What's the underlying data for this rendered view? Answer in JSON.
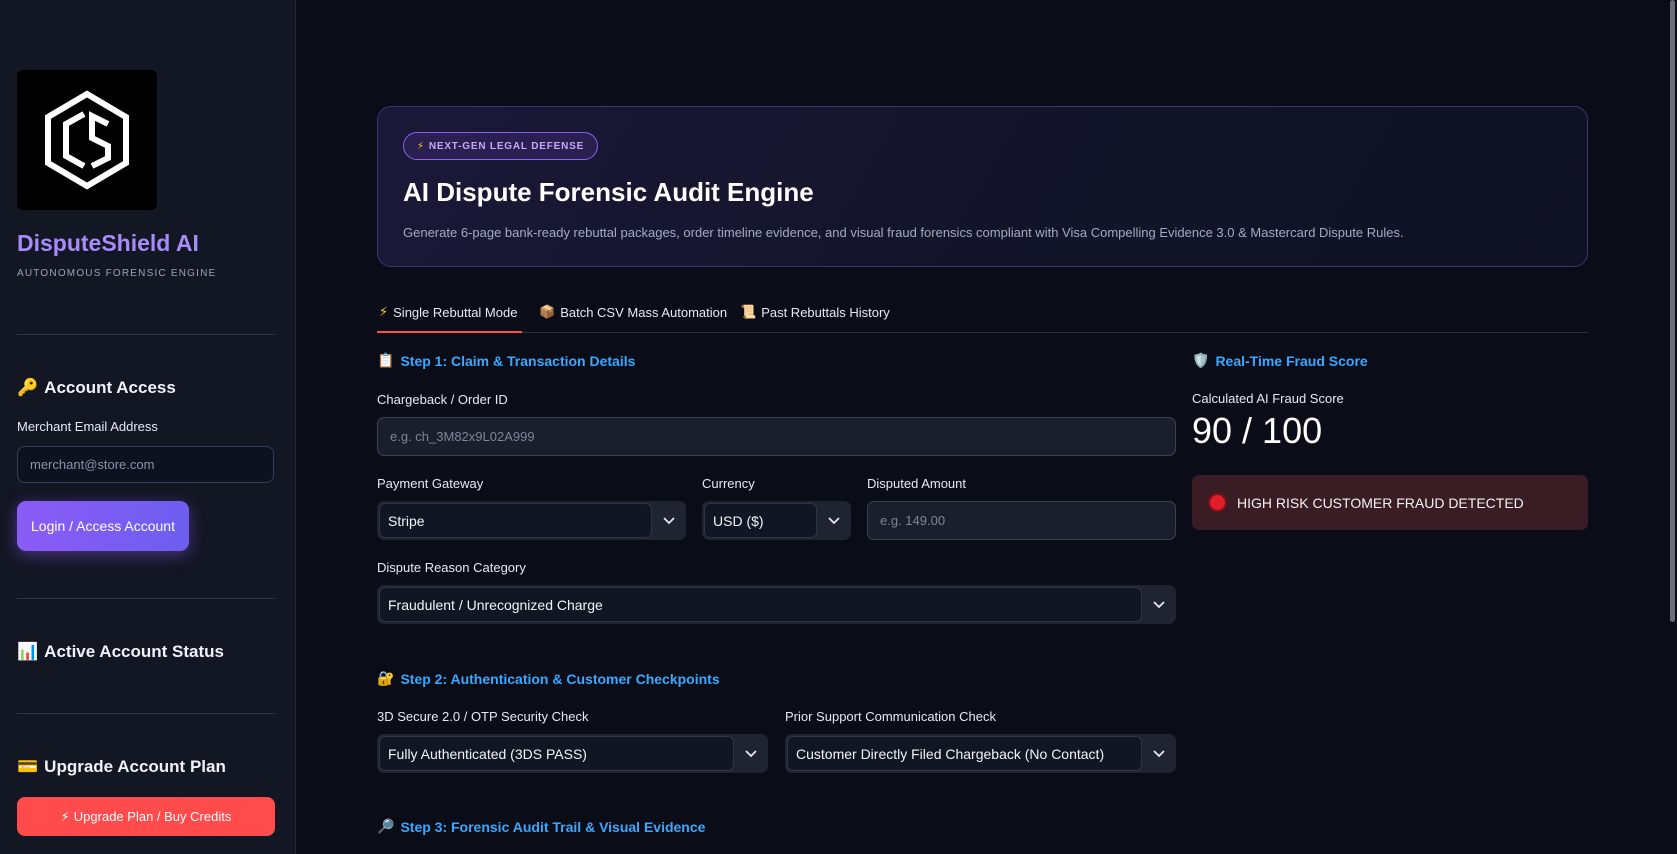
{
  "sidebar": {
    "brand": "DisputeShield AI",
    "brand_sub": "AUTONOMOUS FORENSIC ENGINE",
    "account_access": "Account Access",
    "email_label": "Merchant Email Address",
    "email_placeholder": "merchant@store.com",
    "login_label": "Login / Access Account",
    "status_head": "Active Account Status",
    "upgrade_head": "Upgrade Account Plan",
    "upgrade_button": "Upgrade Plan / Buy Credits"
  },
  "hero": {
    "badge": "NEXT-GEN LEGAL DEFENSE",
    "title": "AI Dispute Forensic Audit Engine",
    "description": "Generate 6-page bank-ready rebuttal packages, order timeline evidence, and visual fraud forensics compliant with Visa Compelling Evidence 3.0 & Mastercard Dispute Rules."
  },
  "tabs": [
    {
      "label": "Single Rebuttal Mode"
    },
    {
      "label": "Batch CSV Mass Automation"
    },
    {
      "label": "Past Rebuttals History"
    }
  ],
  "step1": {
    "title": "Step 1: Claim & Transaction Details",
    "order_label": "Chargeback / Order ID",
    "order_placeholder": "e.g. ch_3M82x9L02A999",
    "gateway_label": "Payment Gateway",
    "gateway_value": "Stripe",
    "currency_label": "Currency",
    "currency_value": "USD ($)",
    "amount_label": "Disputed Amount",
    "amount_placeholder": "e.g. 149.00",
    "reason_label": "Dispute Reason Category",
    "reason_value": "Fraudulent / Unrecognized Charge"
  },
  "step2": {
    "title": "Step 2: Authentication & Customer Checkpoints",
    "secure_label": "3D Secure 2.0 / OTP Security Check",
    "secure_value": "Fully Authenticated (3DS PASS)",
    "support_label": "Prior Support Communication Check",
    "support_value": "Customer Directly Filed Chargeback (No Contact)"
  },
  "step3": {
    "title": "Step 3: Forensic Audit Trail & Visual Evidence"
  },
  "fraud": {
    "title": "Real-Time Fraud Score",
    "score_label": "Calculated AI Fraud Score",
    "score_value": "90 / 100",
    "alert": "HIGH RISK CUSTOMER FRAUD DETECTED"
  },
  "colors": {
    "accent_purple": "#8b5cf6",
    "step_blue": "#3aa8ff",
    "danger": "#ff4b4b"
  }
}
